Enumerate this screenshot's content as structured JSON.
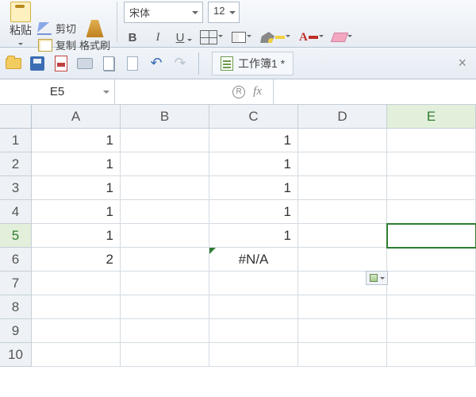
{
  "ribbon": {
    "paste_label": "粘贴",
    "cut_label": "剪切",
    "copy_label": "复制",
    "format_painter_label": "格式刷",
    "font_name": "宋体",
    "font_size": "12",
    "bold": "B",
    "italic": "I",
    "underline": "U",
    "font_color_letter": "A"
  },
  "qat": {
    "undo_glyph": "↶",
    "redo_glyph": "↷"
  },
  "doc": {
    "title": "工作簿1 *",
    "close": "×"
  },
  "namebox": "E5",
  "fx_r": "R",
  "fx_label": "fx",
  "columns": [
    "A",
    "B",
    "C",
    "D",
    "E"
  ],
  "rows": [
    "1",
    "2",
    "3",
    "4",
    "5",
    "6",
    "7",
    "8",
    "9",
    "10"
  ],
  "active_row": "5",
  "active_col": "E",
  "cells": {
    "A1": "1",
    "C1": "1",
    "A2": "1",
    "C2": "1",
    "A3": "1",
    "C3": "1",
    "A4": "1",
    "C4": "1",
    "A5": "1",
    "C5": "1",
    "A6": "2",
    "C6": "#N/A"
  }
}
